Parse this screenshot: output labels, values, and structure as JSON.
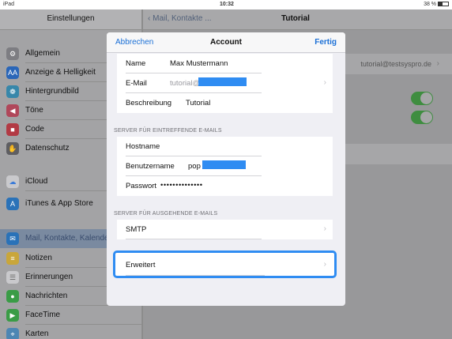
{
  "statusbar": {
    "device": "iPad",
    "time": "10:32",
    "battery": "38 %"
  },
  "sidebar": {
    "title": "Einstellungen",
    "items": [
      {
        "label": "Allgemein",
        "icon": "gear-icon",
        "color": "#8e8e93"
      },
      {
        "label": "Anzeige & Helligkeit",
        "icon": "brightness-icon",
        "color": "#1f7ae0"
      },
      {
        "label": "Hintergrundbild",
        "icon": "wallpaper-icon",
        "color": "#36a8d8"
      },
      {
        "label": "Töne",
        "icon": "sound-icon",
        "color": "#e0405c"
      },
      {
        "label": "Code",
        "icon": "lock-icon",
        "color": "#e03545"
      },
      {
        "label": "Datenschutz",
        "icon": "hand-icon",
        "color": "#6b6b70"
      },
      {
        "label": "iCloud",
        "icon": "cloud-icon",
        "color": "#ffffff"
      },
      {
        "label": "iTunes & App Store",
        "icon": "appstore-icon",
        "color": "#1f8be8"
      },
      {
        "label": "Mail, Kontakte, Kalender",
        "icon": "mail-icon",
        "color": "#1f8be8"
      },
      {
        "label": "Notizen",
        "icon": "notes-icon",
        "color": "#f5c930"
      },
      {
        "label": "Erinnerungen",
        "icon": "reminders-icon",
        "color": "#ffffff"
      },
      {
        "label": "Nachrichten",
        "icon": "messages-icon",
        "color": "#3bc64a"
      },
      {
        "label": "FaceTime",
        "icon": "facetime-icon",
        "color": "#3bc64a"
      },
      {
        "label": "Karten",
        "icon": "maps-icon",
        "color": "#5aa9e6"
      }
    ]
  },
  "detail": {
    "back_label": "Mail, Kontakte ...",
    "title": "Tutorial",
    "account_value": "tutorial@testsyspro.de"
  },
  "modal": {
    "cancel": "Abbrechen",
    "title": "Account",
    "done": "Fertig",
    "account_rows": [
      {
        "label": "Name",
        "value": "Max Mustermann"
      },
      {
        "label": "E-Mail",
        "value": "tutorial@"
      },
      {
        "label": "Beschreibung",
        "value": "Tutorial"
      }
    ],
    "incoming_header": "SERVER FÜR EINTREFFENDE E-MAILS",
    "incoming_rows": [
      {
        "label": "Hostname",
        "value": ""
      },
      {
        "label": "Benutzername",
        "value": "pop"
      },
      {
        "label": "Passwort",
        "value": "••••••••••••••"
      }
    ],
    "outgoing_header": "SERVER FÜR AUSGEHENDE E-MAILS",
    "smtp_label": "SMTP",
    "advanced_label": "Erweitert"
  },
  "colors": {
    "accent": "#1a6fd6",
    "highlight": "#2f8cf2",
    "toggle_on": "#4cd964"
  }
}
